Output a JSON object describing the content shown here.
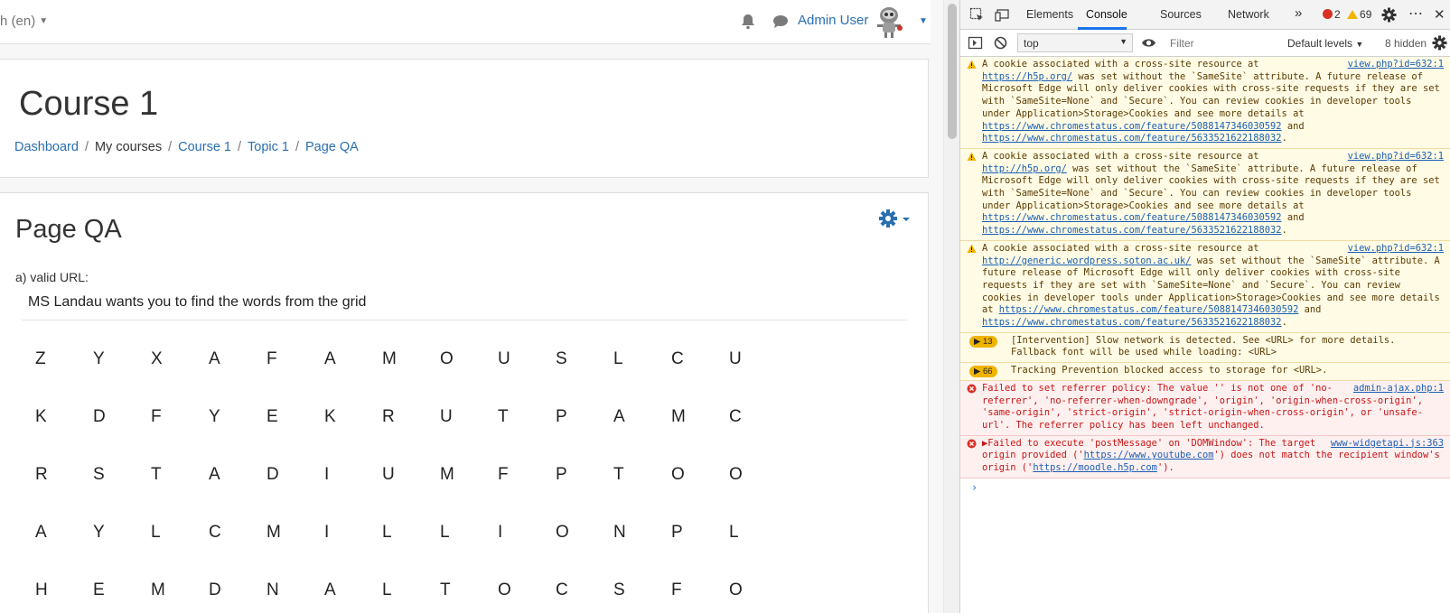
{
  "navbar": {
    "language": "h (en)",
    "username": "Admin User"
  },
  "header": {
    "course_title": "Course 1",
    "breadcrumb": {
      "dashboard": "Dashboard",
      "my_courses": "My courses",
      "course": "Course 1",
      "topic": "Topic 1",
      "page": "Page QA"
    }
  },
  "main": {
    "page_title": "Page QA",
    "url_label": "a) valid URL:",
    "instruction": "MS Landau wants you to find the words from the grid",
    "grid": [
      [
        "Z",
        "Y",
        "X",
        "A",
        "F",
        "A",
        "M",
        "O",
        "U",
        "S",
        "L",
        "C",
        "U"
      ],
      [
        "K",
        "D",
        "F",
        "Y",
        "E",
        "K",
        "R",
        "U",
        "T",
        "P",
        "A",
        "M",
        "C"
      ],
      [
        "R",
        "S",
        "T",
        "A",
        "D",
        "I",
        "U",
        "M",
        "F",
        "P",
        "T",
        "O",
        "O"
      ],
      [
        "A",
        "Y",
        "L",
        "C",
        "M",
        "I",
        "L",
        "L",
        "I",
        "O",
        "N",
        "P",
        "L"
      ],
      [
        "H",
        "E",
        "M",
        "D",
        "N",
        "A",
        "L",
        "T",
        "O",
        "C",
        "S",
        "F",
        "O"
      ]
    ]
  },
  "devtools": {
    "tabs": [
      "Elements",
      "Console",
      "Sources",
      "Network"
    ],
    "more_tabs": "»",
    "error_count": "2",
    "warning_count": "69",
    "more": "⋯",
    "close": "✕",
    "context": "top",
    "filter_placeholder": "Filter",
    "levels": "Default levels",
    "hidden": "8 hidden",
    "messages": {
      "w1": {
        "src": "view.php?id=632:1",
        "pre": "A cookie associated with a cross-site resource at ",
        "link": "https://h5p.org/",
        "mid": " was set without the `SameSite` attribute. A future release of Microsoft Edge will only deliver cookies with cross-site requests if they are set with `SameSite=None` and `Secure`. You can review cookies in developer tools under Application>Storage>Cookies and see more details at ",
        "l1": "https://www.chromestatus.com/feature/5088147346030592",
        "and": " and ",
        "l2": "https://www.chromestatus.com/feature/5633521622188032",
        "end": "."
      },
      "w2": {
        "src": "view.php?id=632:1",
        "pre": "A cookie associated with a cross-site resource at ",
        "link": "http://h5p.org/",
        "mid": " was set without the `SameSite` attribute. A future release of Microsoft Edge will only deliver cookies with cross-site requests if they are set with `SameSite=None` and `Secure`. You can review cookies in developer tools under Application>Storage>Cookies and see more details at ",
        "l1": "https://www.chromestatus.com/feature/5088147346030592",
        "and": " and ",
        "l2": "https://www.chromestatus.com/feature/5633521622188032",
        "end": "."
      },
      "w3": {
        "src": "view.php?id=632:1",
        "pre": "A cookie associated with a cross-site resource at ",
        "link": "http://generic.wordpress.soton.ac.uk/",
        "mid": " was set without the `SameSite` attribute. A future release of Microsoft Edge will only deliver cookies with cross-site requests if they are set with `SameSite=None` and `Secure`. You can review cookies in developer tools under Application>Storage>Cookies and see more details at ",
        "l1": "https://www.chromestatus.com/feature/5088147346030592",
        "and": " and ",
        "l2": "https://www.chromestatus.com/feature/5633521622188032",
        "end": "."
      },
      "i1": {
        "count": "13",
        "text": "[Intervention] Slow network is detected. See <URL> for more details. Fallback font will be used while loading: <URL>"
      },
      "i2": {
        "count": "66",
        "text": "Tracking Prevention blocked access to storage for <URL>."
      },
      "e1": {
        "src": "admin-ajax.php:1",
        "text": "Failed to set referrer policy: The value '' is not one of 'no-referrer', 'no-referrer-when-downgrade', 'origin', 'origin-when-cross-origin', 'same-origin', 'strict-origin', 'strict-origin-when-cross-origin', or 'unsafe-url'. The referrer policy has been left unchanged."
      },
      "e2": {
        "src": "www-widgetapi.js:363",
        "pre": "▶Failed to execute 'postMessage' on 'DOMWindow': The target origin provided ('",
        "l1": "https://www.youtube.com",
        "mid": "') does not match the recipient window's origin ('",
        "l2": "https://moodle.h5p.com",
        "end": "')."
      }
    },
    "prompt": "›"
  }
}
